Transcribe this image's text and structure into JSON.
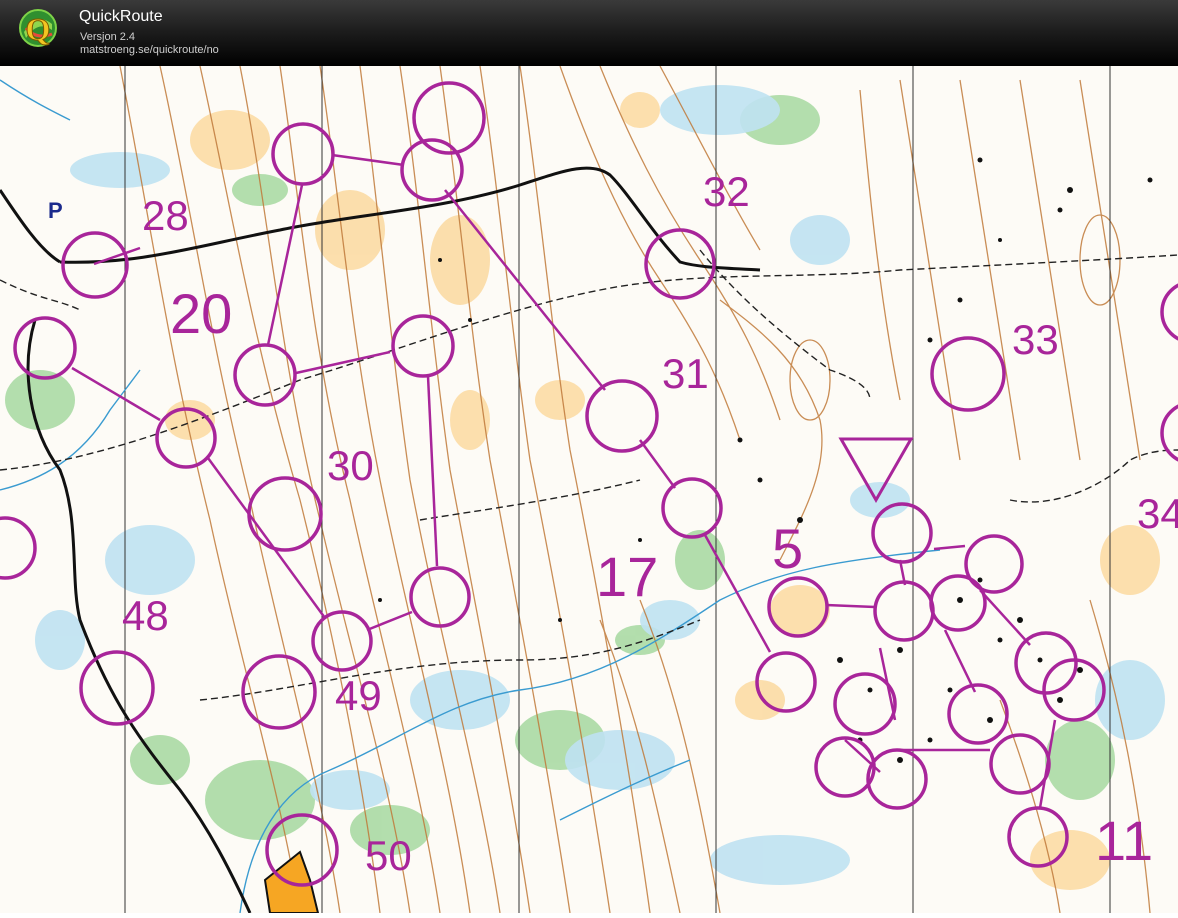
{
  "app": {
    "title": "QuickRoute",
    "version": "Versjon 2.4",
    "url": "matstroeng.se/quickroute/no"
  },
  "map": {
    "parking_symbol": "P",
    "start_symbol": "start-triangle-icon",
    "colors": {
      "course": "#a8259a",
      "contour": "#c07a3a",
      "water": "#4aa3d8",
      "vegetation": "#9fd39a",
      "open_land": "#fbd9a0",
      "road": "#ffb830"
    },
    "control_numbers": [
      "28",
      "20",
      "30",
      "48",
      "49",
      "50",
      "31",
      "32",
      "17",
      "5",
      "33",
      "34",
      "11"
    ]
  }
}
